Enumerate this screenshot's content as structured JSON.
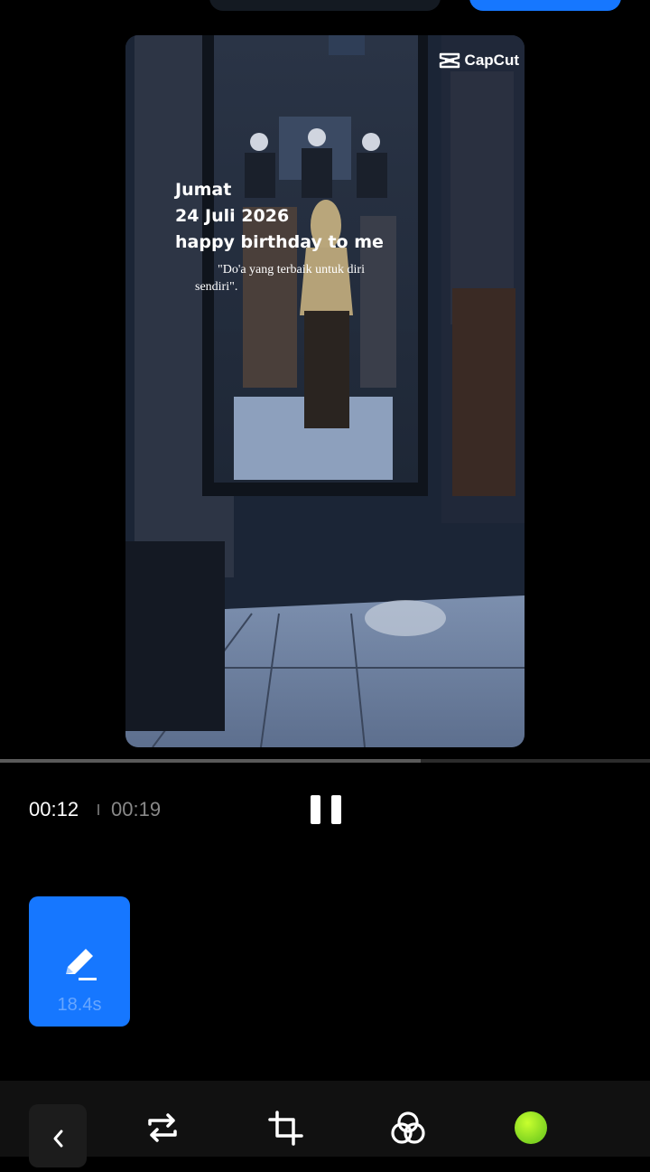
{
  "watermark": {
    "label": "CapCut"
  },
  "overlay": {
    "lines": [
      "Jumat",
      "24 Juli 2026",
      "happy birthday to me"
    ],
    "quote": "\"Do'a yang terbaik untuk diri sendiri\"."
  },
  "player": {
    "current_time": "00:12",
    "total_time": "00:19",
    "progress": 0.647
  },
  "clip": {
    "duration": "18.4s"
  },
  "toolbar": {
    "items": [
      "back-icon",
      "swap-icon",
      "crop-icon",
      "filters-icon",
      "color-dot"
    ]
  },
  "colors": {
    "accent": "#1677ff",
    "dot": "#9fe31b"
  }
}
